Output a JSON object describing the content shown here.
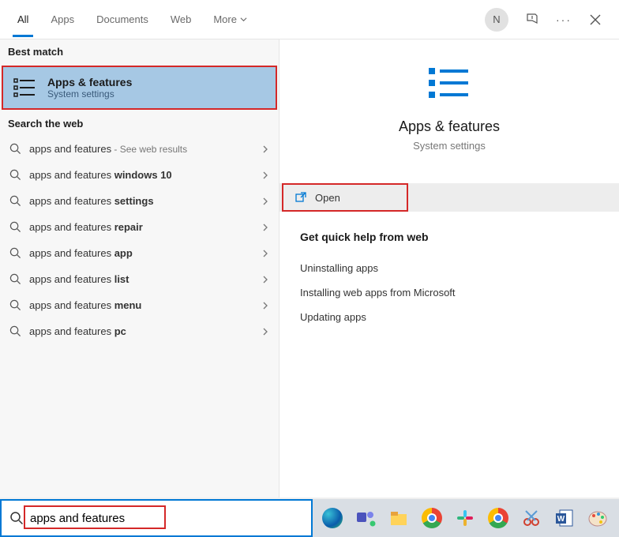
{
  "tabs": [
    "All",
    "Apps",
    "Documents",
    "Web",
    "More"
  ],
  "active_tab": 0,
  "avatar_initial": "N",
  "left": {
    "best_match_header": "Best match",
    "best_match": {
      "title": "Apps & features",
      "sub": "System settings"
    },
    "web_header": "Search the web",
    "web_results": [
      {
        "prefix": "apps and features",
        "bold": "",
        "sub": " - See web results"
      },
      {
        "prefix": "apps and features ",
        "bold": "windows 10",
        "sub": ""
      },
      {
        "prefix": "apps and features ",
        "bold": "settings",
        "sub": ""
      },
      {
        "prefix": "apps and features ",
        "bold": "repair",
        "sub": ""
      },
      {
        "prefix": "apps and features ",
        "bold": "app",
        "sub": ""
      },
      {
        "prefix": "apps and features ",
        "bold": "list",
        "sub": ""
      },
      {
        "prefix": "apps and features ",
        "bold": "menu",
        "sub": ""
      },
      {
        "prefix": "apps and features ",
        "bold": "pc",
        "sub": ""
      }
    ]
  },
  "right": {
    "title": "Apps & features",
    "sub": "System settings",
    "open_label": "Open",
    "help_title": "Get quick help from web",
    "help_links": [
      "Uninstalling apps",
      "Installing web apps from Microsoft",
      "Updating apps"
    ]
  },
  "search_value": "apps and features",
  "taskbar_icons": [
    "edge",
    "teams",
    "explorer",
    "chrome",
    "slack",
    "chrome2",
    "snip",
    "word",
    "paint"
  ]
}
